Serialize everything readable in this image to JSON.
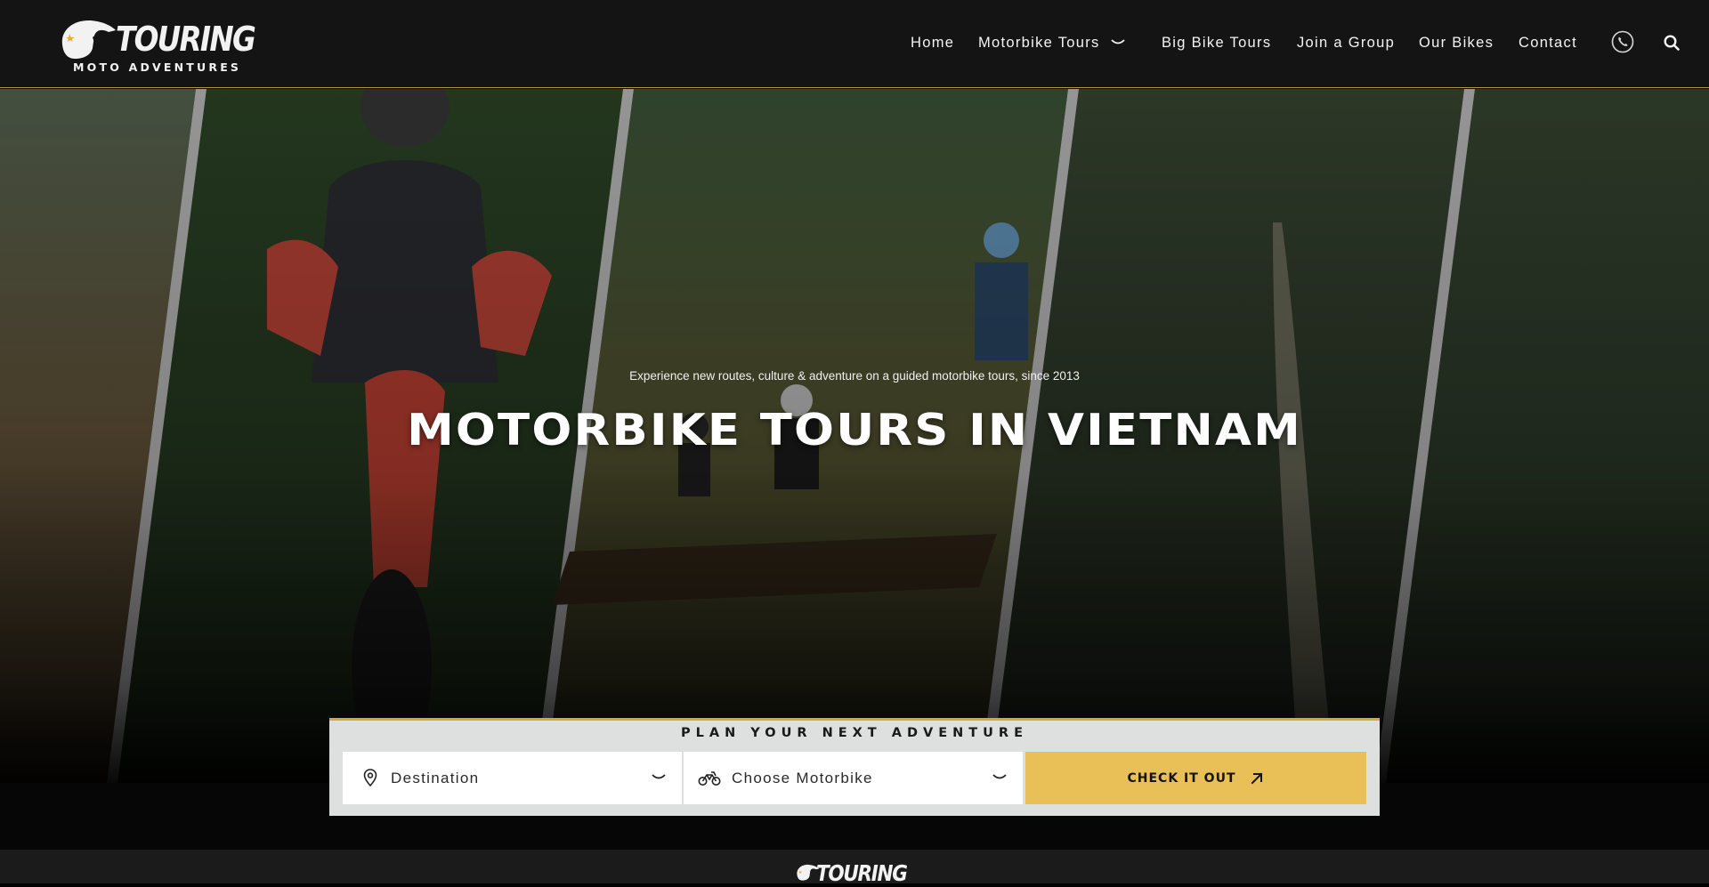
{
  "brand": {
    "name": "TOURING",
    "tagline": "MOTO ADVENTURES"
  },
  "nav": {
    "items": [
      {
        "label": "Home"
      },
      {
        "label": "Motorbike Tours"
      },
      {
        "label": "Big Bike Tours"
      },
      {
        "label": "Join a Group"
      },
      {
        "label": "Our Bikes"
      },
      {
        "label": "Contact"
      }
    ],
    "icons": [
      "chevron-down-icon",
      "phone-icon",
      "search-icon"
    ]
  },
  "hero": {
    "subtitle": "Experience new routes, culture & adventure on a guided motorbike tours, since 2013",
    "title": "MOTORBIKE TOURS IN VIETNAM"
  },
  "planner": {
    "title": "PLAN YOUR NEXT ADVENTURE",
    "destination_label": "Destination",
    "motorbike_label": "Choose Motorbike",
    "submit_label": "CHECK IT OUT",
    "icons": [
      "location-pin-icon",
      "motorbike-icon",
      "arrow-up-right-icon"
    ]
  },
  "footer": {
    "brand": "TOURING"
  },
  "colors": {
    "header_bg": "#141414",
    "accent": "#e9bf57",
    "accent_border": "#d9a836",
    "panel_bg": "#dde0df"
  }
}
